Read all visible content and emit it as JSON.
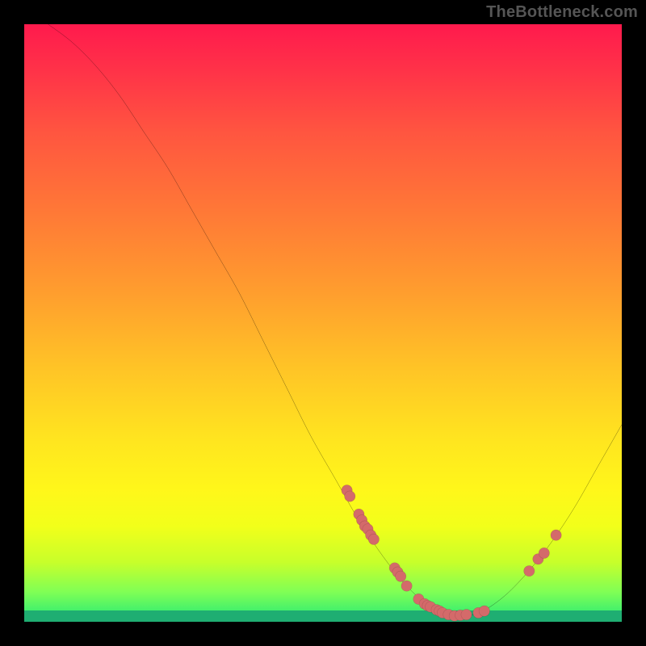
{
  "watermark": "TheBottleneck.com",
  "chart_data": {
    "type": "line",
    "title": "",
    "xlabel": "",
    "ylabel": "",
    "xlim": [
      0,
      100
    ],
    "ylim": [
      0,
      100
    ],
    "grid": false,
    "curve": [
      {
        "x": 4,
        "y": 100
      },
      {
        "x": 8,
        "y": 97
      },
      {
        "x": 12,
        "y": 93
      },
      {
        "x": 16,
        "y": 88
      },
      {
        "x": 20,
        "y": 82
      },
      {
        "x": 24,
        "y": 76
      },
      {
        "x": 28,
        "y": 69
      },
      {
        "x": 32,
        "y": 62
      },
      {
        "x": 36,
        "y": 55
      },
      {
        "x": 40,
        "y": 47
      },
      {
        "x": 44,
        "y": 39
      },
      {
        "x": 48,
        "y": 31
      },
      {
        "x": 52,
        "y": 24
      },
      {
        "x": 56,
        "y": 17
      },
      {
        "x": 60,
        "y": 11
      },
      {
        "x": 64,
        "y": 6
      },
      {
        "x": 68,
        "y": 2.5
      },
      {
        "x": 72,
        "y": 1
      },
      {
        "x": 76,
        "y": 1.5
      },
      {
        "x": 80,
        "y": 4
      },
      {
        "x": 84,
        "y": 8
      },
      {
        "x": 88,
        "y": 13
      },
      {
        "x": 92,
        "y": 19
      },
      {
        "x": 96,
        "y": 26
      },
      {
        "x": 100,
        "y": 33
      }
    ],
    "points": [
      {
        "x": 54,
        "y": 22
      },
      {
        "x": 54.5,
        "y": 21
      },
      {
        "x": 56,
        "y": 18
      },
      {
        "x": 56.5,
        "y": 17
      },
      {
        "x": 57,
        "y": 16
      },
      {
        "x": 57.5,
        "y": 15.5
      },
      {
        "x": 58,
        "y": 14.5
      },
      {
        "x": 58.5,
        "y": 13.8
      },
      {
        "x": 62,
        "y": 9
      },
      {
        "x": 62.5,
        "y": 8.3
      },
      {
        "x": 63,
        "y": 7.6
      },
      {
        "x": 64,
        "y": 6
      },
      {
        "x": 66,
        "y": 3.8
      },
      {
        "x": 67,
        "y": 3
      },
      {
        "x": 67.5,
        "y": 2.7
      },
      {
        "x": 68,
        "y": 2.5
      },
      {
        "x": 69,
        "y": 2
      },
      {
        "x": 69.5,
        "y": 1.8
      },
      {
        "x": 70,
        "y": 1.5
      },
      {
        "x": 71,
        "y": 1.2
      },
      {
        "x": 72,
        "y": 1
      },
      {
        "x": 73,
        "y": 1.1
      },
      {
        "x": 74,
        "y": 1.2
      },
      {
        "x": 76,
        "y": 1.5
      },
      {
        "x": 77,
        "y": 1.8
      },
      {
        "x": 84.5,
        "y": 8.5
      },
      {
        "x": 86,
        "y": 10.5
      },
      {
        "x": 87,
        "y": 11.5
      },
      {
        "x": 89,
        "y": 14.5
      }
    ]
  }
}
